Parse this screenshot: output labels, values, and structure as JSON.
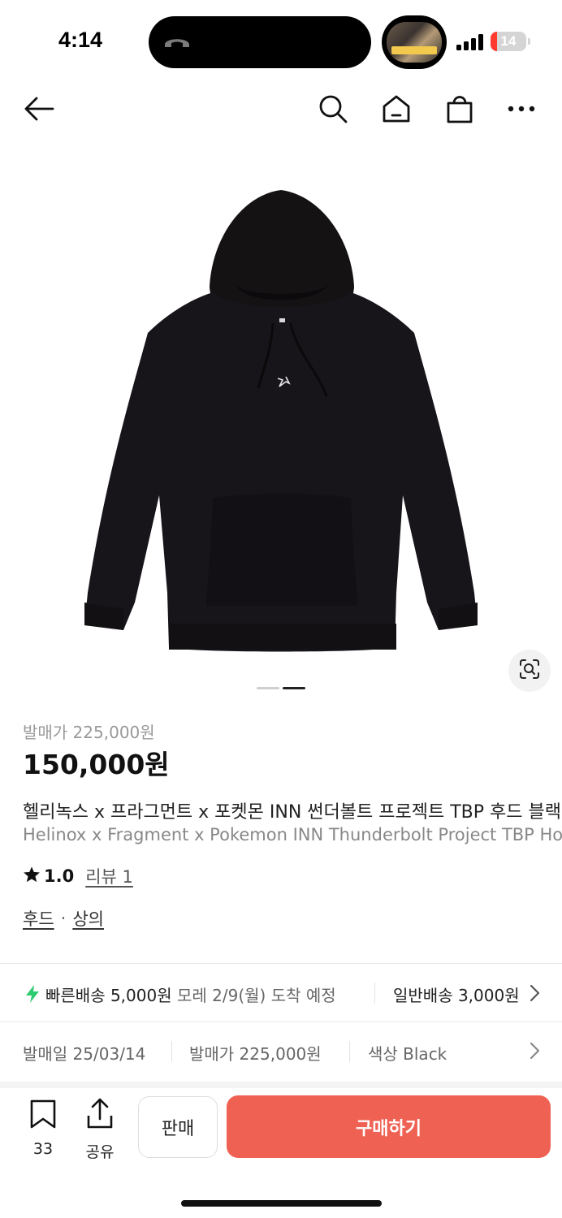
{
  "status_bar": {
    "time": "4:14",
    "battery_level": "14"
  },
  "nav": {
    "icons": [
      "back-arrow-icon",
      "search-icon",
      "home-icon",
      "shopping-bag-icon",
      "more-icon"
    ]
  },
  "product_image": {
    "description_icon": "hoodie-image",
    "indicator": {
      "total": 2,
      "active": 2
    }
  },
  "product": {
    "release_price_label": "발매가 225,000원",
    "price": "150,000원",
    "title_ko": "헬리녹스 x 프라그먼트 x 포켓몬 INN 썬더볼트 프로젝트 TBP 후드 블랙",
    "title_en": "Helinox x Fragment x Pokemon INN Thunderbolt Project TBP Hoodie Black",
    "rating": "1.0",
    "review_label": "리뷰 1",
    "categories": [
      "후드",
      "상의"
    ],
    "category_separator": "·"
  },
  "delivery": {
    "fast_label": "빠른배송 5,000원",
    "fast_eta": "모레 2/9(월) 도착 예정",
    "normal_label": "일반배송 3,000원",
    "bolt_color": "#2ecc71"
  },
  "info": {
    "release_date": "발매일 25/03/14",
    "release_price": "발매가 225,000원",
    "color": "색상 Black"
  },
  "actions": {
    "save_count": "33",
    "share_label": "공유",
    "sell_label": "판매",
    "buy_label": "구매하기",
    "buy_color": "#ef6253"
  }
}
